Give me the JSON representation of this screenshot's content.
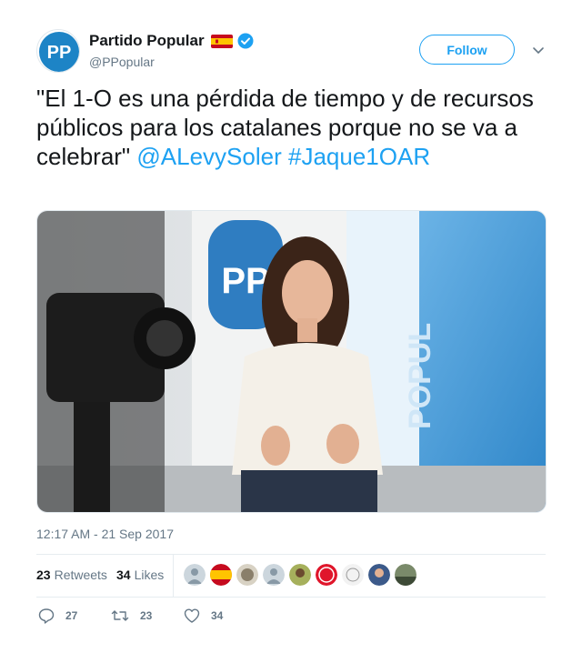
{
  "account": {
    "display_name": "Partido Popular",
    "handle": "@PPopular",
    "avatar_text": "PP",
    "flag_icon": "spain-flag-icon",
    "verified_icon": "verified-badge-icon"
  },
  "follow_button": {
    "label": "Follow"
  },
  "menu_icon": "chevron-down-icon",
  "tweet": {
    "text_plain": "\"El 1-O es una pérdida de tiempo y de recursos públicos para los catalanes porque no se va a celebrar\"",
    "mention": "@ALevySoler",
    "hashtag": "#Jaque1OAR"
  },
  "media": {
    "sign_text": "POPUL",
    "logo_text": "PP"
  },
  "timestamp": "12:17 AM - 21 Sep 2017",
  "stats": {
    "retweets_count": "23",
    "retweets_label": "Retweets",
    "likes_count": "34",
    "likes_label": "Likes"
  },
  "actions": {
    "reply_count": "27",
    "retweet_count": "23",
    "like_count": "34"
  },
  "colors": {
    "accent": "#1da1f2",
    "text_primary": "#14171a",
    "text_secondary": "#657786"
  }
}
